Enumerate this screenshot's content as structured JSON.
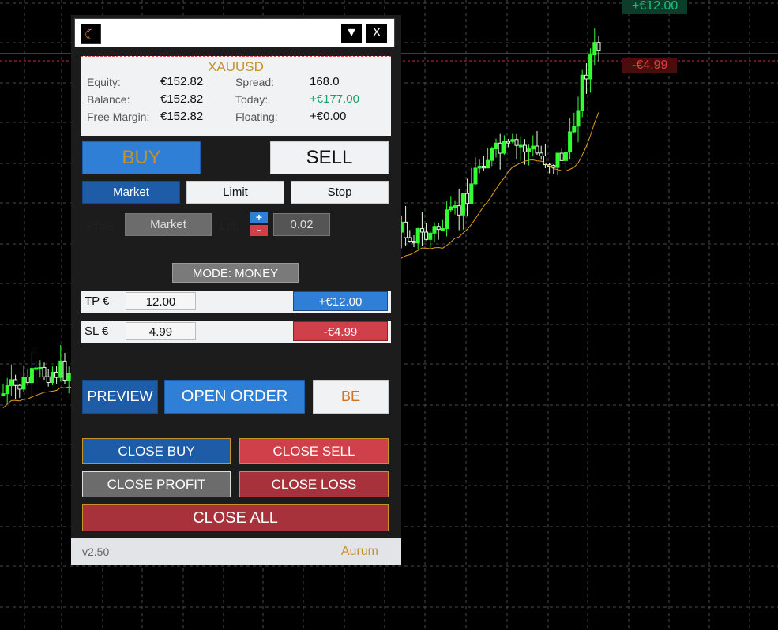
{
  "chart": {
    "right_labels": {
      "tp_value": "+€12.00",
      "sl_value": "-€4.99"
    },
    "colors": {
      "background": "#000000",
      "grid": "#4a4a4a",
      "bull": "#33ff33",
      "bear": "#e8ffe0",
      "ma": "#e0a020"
    }
  },
  "panel": {
    "titlebar": {
      "logo_icon": "crescent-moon-icon",
      "minimize_icon": "▼",
      "close_label": "X"
    },
    "info": {
      "symbol": "XAUUSD",
      "equity_label": "Equity:",
      "equity_value": "€152.82",
      "balance_label": "Balance:",
      "balance_value": "€152.82",
      "free_margin_label": "Free Margin:",
      "free_margin_value": "€152.82",
      "spread_label": "Spread:",
      "spread_value": "168.0",
      "today_label": "Today:",
      "today_value": "+€177.00",
      "floating_label": "Floating:",
      "floating_value": "+€0.00"
    },
    "buy_label": "BUY",
    "sell_label": "SELL",
    "order_types": {
      "market": "Market",
      "limit": "Limit",
      "stop": "Stop"
    },
    "price_label": "Price:",
    "price_value": "Market",
    "lot_label": "Lot:",
    "lot_plus": "+",
    "lot_minus": "-",
    "lot_value": "0.02",
    "mode_label": "MODE: MONEY",
    "tp": {
      "label": "TP €",
      "value": "12.00",
      "result": "+€12.00"
    },
    "sl": {
      "label": "SL €",
      "value": "4.99",
      "result": "-€4.99"
    },
    "preview_label": "PREVIEW",
    "open_order_label": "OPEN ORDER",
    "be_label": "BE",
    "close_buy_label": "CLOSE BUY",
    "close_sell_label": "CLOSE SELL",
    "close_profit_label": "CLOSE PROFIT",
    "close_loss_label": "CLOSE LOSS",
    "close_all_label": "CLOSE ALL",
    "version": "v2.50",
    "brand": "Aurum"
  }
}
